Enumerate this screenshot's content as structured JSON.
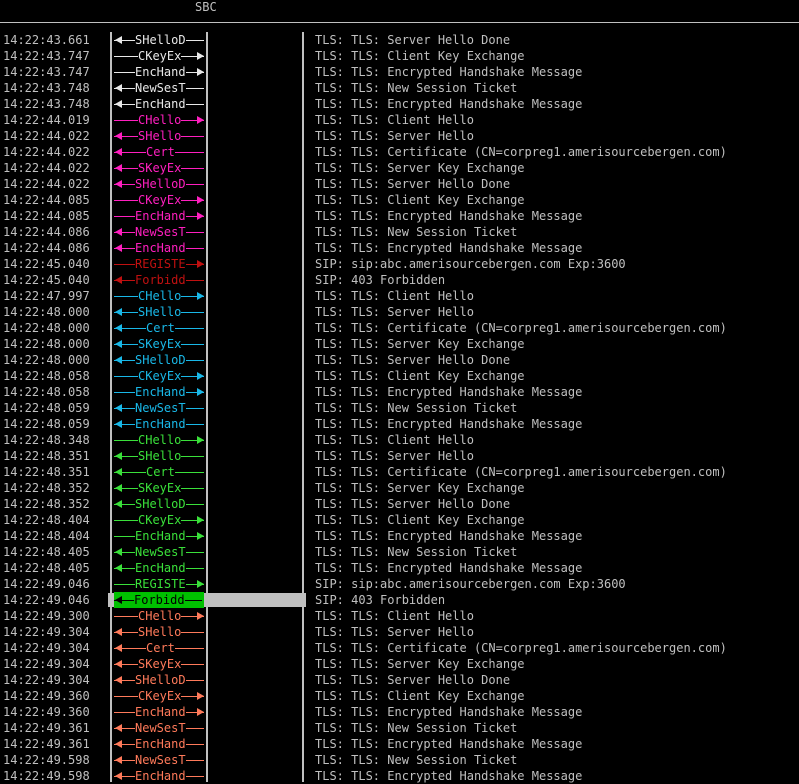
{
  "header": {
    "title": "SBC"
  },
  "colors": {
    "white": "#e8e8e8",
    "magenta": "#ff1fbf",
    "red": "#c01010",
    "cyan": "#19b8e8",
    "green": "#3ae03a",
    "salmon": "#ff7a5a",
    "selected_bg": "#00c000"
  },
  "rows": [
    {
      "time": "14:22:43.661",
      "label": "SHelloD",
      "dir": "left",
      "color": "white",
      "desc": "TLS: TLS: Server Hello Done"
    },
    {
      "time": "14:22:43.747",
      "label": "CKeyEx",
      "dir": "right",
      "color": "white",
      "desc": "TLS: TLS: Client Key Exchange"
    },
    {
      "time": "14:22:43.747",
      "label": "EncHand",
      "dir": "right",
      "color": "white",
      "desc": "TLS: TLS: Encrypted Handshake Message"
    },
    {
      "time": "14:22:43.748",
      "label": "NewSesT",
      "dir": "left",
      "color": "white",
      "desc": "TLS: TLS: New Session Ticket"
    },
    {
      "time": "14:22:43.748",
      "label": "EncHand",
      "dir": "left",
      "color": "white",
      "desc": "TLS: TLS: Encrypted Handshake Message"
    },
    {
      "time": "14:22:44.019",
      "label": "CHello",
      "dir": "right",
      "color": "magenta",
      "desc": "TLS: TLS: Client Hello"
    },
    {
      "time": "14:22:44.022",
      "label": "SHello",
      "dir": "left",
      "color": "magenta",
      "desc": "TLS: TLS: Server Hello"
    },
    {
      "time": "14:22:44.022",
      "label": "Cert",
      "dir": "left",
      "color": "magenta",
      "desc": "TLS: TLS: Certificate (CN=corpreg1.amerisourcebergen.com)"
    },
    {
      "time": "14:22:44.022",
      "label": "SKeyEx",
      "dir": "left",
      "color": "magenta",
      "desc": "TLS: TLS: Server Key Exchange"
    },
    {
      "time": "14:22:44.022",
      "label": "SHelloD",
      "dir": "left",
      "color": "magenta",
      "desc": "TLS: TLS: Server Hello Done"
    },
    {
      "time": "14:22:44.085",
      "label": "CKeyEx",
      "dir": "right",
      "color": "magenta",
      "desc": "TLS: TLS: Client Key Exchange"
    },
    {
      "time": "14:22:44.085",
      "label": "EncHand",
      "dir": "right",
      "color": "magenta",
      "desc": "TLS: TLS: Encrypted Handshake Message"
    },
    {
      "time": "14:22:44.086",
      "label": "NewSesT",
      "dir": "left",
      "color": "magenta",
      "desc": "TLS: TLS: New Session Ticket"
    },
    {
      "time": "14:22:44.086",
      "label": "EncHand",
      "dir": "left",
      "color": "magenta",
      "desc": "TLS: TLS: Encrypted Handshake Message"
    },
    {
      "time": "14:22:45.040",
      "label": "REGISTE",
      "dir": "right",
      "color": "red",
      "desc": "SIP: sip:abc.amerisourcebergen.com Exp:3600"
    },
    {
      "time": "14:22:45.040",
      "label": "Forbidd",
      "dir": "left",
      "color": "red",
      "desc": "SIP: 403 Forbidden"
    },
    {
      "time": "14:22:47.997",
      "label": "CHello",
      "dir": "right",
      "color": "cyan",
      "desc": "TLS: TLS: Client Hello"
    },
    {
      "time": "14:22:48.000",
      "label": "SHello",
      "dir": "left",
      "color": "cyan",
      "desc": "TLS: TLS: Server Hello"
    },
    {
      "time": "14:22:48.000",
      "label": "Cert",
      "dir": "left",
      "color": "cyan",
      "desc": "TLS: TLS: Certificate (CN=corpreg1.amerisourcebergen.com)"
    },
    {
      "time": "14:22:48.000",
      "label": "SKeyEx",
      "dir": "left",
      "color": "cyan",
      "desc": "TLS: TLS: Server Key Exchange"
    },
    {
      "time": "14:22:48.000",
      "label": "SHelloD",
      "dir": "left",
      "color": "cyan",
      "desc": "TLS: TLS: Server Hello Done"
    },
    {
      "time": "14:22:48.058",
      "label": "CKeyEx",
      "dir": "right",
      "color": "cyan",
      "desc": "TLS: TLS: Client Key Exchange"
    },
    {
      "time": "14:22:48.058",
      "label": "EncHand",
      "dir": "right",
      "color": "cyan",
      "desc": "TLS: TLS: Encrypted Handshake Message"
    },
    {
      "time": "14:22:48.059",
      "label": "NewSesT",
      "dir": "left",
      "color": "cyan",
      "desc": "TLS: TLS: New Session Ticket"
    },
    {
      "time": "14:22:48.059",
      "label": "EncHand",
      "dir": "left",
      "color": "cyan",
      "desc": "TLS: TLS: Encrypted Handshake Message"
    },
    {
      "time": "14:22:48.348",
      "label": "CHello",
      "dir": "right",
      "color": "green",
      "desc": "TLS: TLS: Client Hello"
    },
    {
      "time": "14:22:48.351",
      "label": "SHello",
      "dir": "left",
      "color": "green",
      "desc": "TLS: TLS: Server Hello"
    },
    {
      "time": "14:22:48.351",
      "label": "Cert",
      "dir": "left",
      "color": "green",
      "desc": "TLS: TLS: Certificate (CN=corpreg1.amerisourcebergen.com)"
    },
    {
      "time": "14:22:48.352",
      "label": "SKeyEx",
      "dir": "left",
      "color": "green",
      "desc": "TLS: TLS: Server Key Exchange"
    },
    {
      "time": "14:22:48.352",
      "label": "SHelloD",
      "dir": "left",
      "color": "green",
      "desc": "TLS: TLS: Server Hello Done"
    },
    {
      "time": "14:22:48.404",
      "label": "CKeyEx",
      "dir": "right",
      "color": "green",
      "desc": "TLS: TLS: Client Key Exchange"
    },
    {
      "time": "14:22:48.404",
      "label": "EncHand",
      "dir": "right",
      "color": "green",
      "desc": "TLS: TLS: Encrypted Handshake Message"
    },
    {
      "time": "14:22:48.405",
      "label": "NewSesT",
      "dir": "left",
      "color": "green",
      "desc": "TLS: TLS: New Session Ticket"
    },
    {
      "time": "14:22:48.405",
      "label": "EncHand",
      "dir": "left",
      "color": "green",
      "desc": "TLS: TLS: Encrypted Handshake Message"
    },
    {
      "time": "14:22:49.046",
      "label": "REGISTE",
      "dir": "right",
      "color": "green",
      "desc": "SIP: sip:abc.amerisourcebergen.com Exp:3600"
    },
    {
      "time": "14:22:49.046",
      "label": "Forbidd",
      "dir": "left",
      "color": "green",
      "desc": "SIP: 403 Forbidden",
      "selected": true
    },
    {
      "time": "14:22:49.300",
      "label": "CHello",
      "dir": "right",
      "color": "salmon",
      "desc": "TLS: TLS: Client Hello"
    },
    {
      "time": "14:22:49.304",
      "label": "SHello",
      "dir": "left",
      "color": "salmon",
      "desc": "TLS: TLS: Server Hello"
    },
    {
      "time": "14:22:49.304",
      "label": "Cert",
      "dir": "left",
      "color": "salmon",
      "desc": "TLS: TLS: Certificate (CN=corpreg1.amerisourcebergen.com)"
    },
    {
      "time": "14:22:49.304",
      "label": "SKeyEx",
      "dir": "left",
      "color": "salmon",
      "desc": "TLS: TLS: Server Key Exchange"
    },
    {
      "time": "14:22:49.304",
      "label": "SHelloD",
      "dir": "left",
      "color": "salmon",
      "desc": "TLS: TLS: Server Hello Done"
    },
    {
      "time": "14:22:49.360",
      "label": "CKeyEx",
      "dir": "right",
      "color": "salmon",
      "desc": "TLS: TLS: Client Key Exchange"
    },
    {
      "time": "14:22:49.360",
      "label": "EncHand",
      "dir": "right",
      "color": "salmon",
      "desc": "TLS: TLS: Encrypted Handshake Message"
    },
    {
      "time": "14:22:49.361",
      "label": "NewSesT",
      "dir": "left",
      "color": "salmon",
      "desc": "TLS: TLS: New Session Ticket"
    },
    {
      "time": "14:22:49.361",
      "label": "EncHand",
      "dir": "left",
      "color": "salmon",
      "desc": "TLS: TLS: Encrypted Handshake Message"
    },
    {
      "time": "14:22:49.598",
      "label": "NewSesT",
      "dir": "left",
      "color": "salmon",
      "desc": "TLS: TLS: New Session Ticket"
    },
    {
      "time": "14:22:49.598",
      "label": "EncHand",
      "dir": "left",
      "color": "salmon",
      "desc": "TLS: TLS: Encrypted Handshake Message"
    }
  ]
}
